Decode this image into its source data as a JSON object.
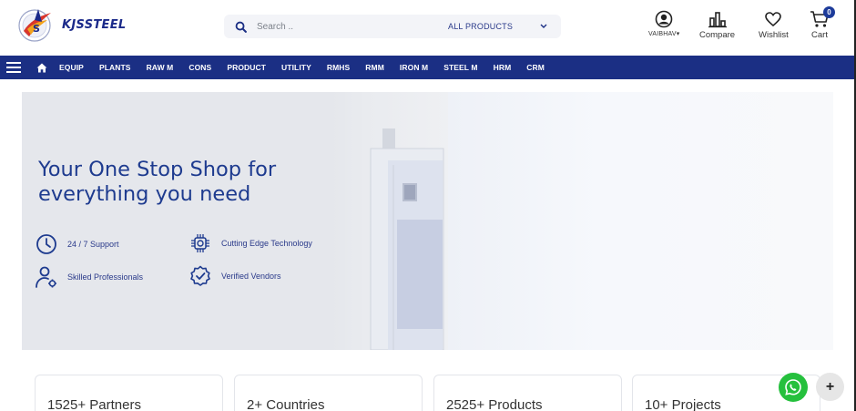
{
  "brand": {
    "name": "KJSSTEEL",
    "logo_icon": "kjs-emblem-icon"
  },
  "search": {
    "placeholder": "Search ..",
    "category": "ALL PRODUCTS"
  },
  "header_actions": {
    "account_label": "VAIBHAV▾",
    "compare_label": "Compare",
    "wishlist_label": "Wishlist",
    "cart_label": "Cart",
    "cart_count": "0"
  },
  "nav": {
    "items": [
      "EQUIP",
      "PLANTS",
      "RAW M",
      "CONS",
      "PRODUCT",
      "UTILITY",
      "RMHS",
      "RMM",
      "IRON M",
      "STEEL M",
      "HRM",
      "CRM"
    ]
  },
  "hero": {
    "title": "Your One Stop Shop for everything you need",
    "features": [
      {
        "label": "24 / 7 Support",
        "icon": "clock-icon"
      },
      {
        "label": "Cutting Edge Technology",
        "icon": "chip-gear-icon"
      },
      {
        "label": "Skilled Professionals",
        "icon": "user-gear-icon"
      },
      {
        "label": "Verified Vendors",
        "icon": "verified-badge-icon"
      }
    ]
  },
  "stats": [
    {
      "label": "1525+ Partners"
    },
    {
      "label": "2+ Countries"
    },
    {
      "label": "2525+ Products"
    },
    {
      "label": "10+ Projects"
    }
  ],
  "floating": {
    "plus_label": "+"
  },
  "colors": {
    "primary": "#1b2f84",
    "accent": "#1e3b8f",
    "whatsapp": "#25c03d"
  }
}
